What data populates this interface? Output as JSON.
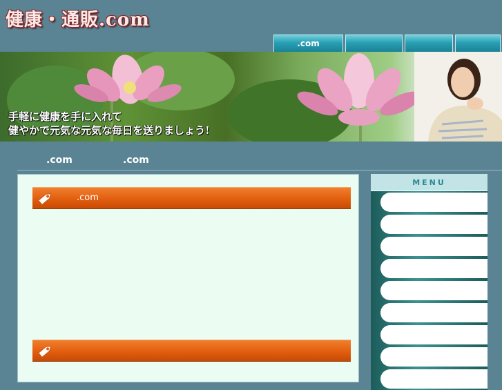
{
  "header": {
    "logo": "健康・通販.com"
  },
  "topnav": [
    {
      "label": ".com"
    },
    {
      "label": ""
    },
    {
      "label": ""
    },
    {
      "label": ""
    }
  ],
  "banner": {
    "caption_line1": "手軽に健康を手に入れて",
    "caption_line2": "健やかで元気な元気な毎日を送りましょう!"
  },
  "subnav": {
    "item1": ".com",
    "item2": ".com"
  },
  "main": {
    "sections": [
      {
        "label": ".com"
      },
      {
        "label": ""
      }
    ]
  },
  "sidebar": {
    "heading": "MENU",
    "items": [
      "",
      "",
      "",
      "",
      "",
      "",
      "",
      "",
      ""
    ]
  },
  "colors": {
    "accent": "#e25e0e",
    "nav": "#28a0b4",
    "background": "#5a8494"
  }
}
